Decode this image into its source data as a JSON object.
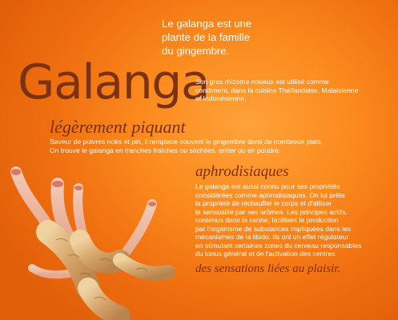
{
  "intro": {
    "lines": [
      "Le galanga est une",
      "plante de la famille",
      "du gingembre."
    ]
  },
  "title": "Galanga",
  "rhizome": {
    "lines": [
      "Son gros rhizome noueux est utilisé comme",
      "condiment, dans la cuisine Thaïlandaise, Malaisienne",
      "et Indonésienne."
    ]
  },
  "flavor": {
    "heading": "légèrement piquant",
    "lines": [
      "Saveur de poivres noirs et pin, il remplace souvent le gingembre dans de nombreux plats.",
      "On trouve le galanga en tranches fraîches ou séchées, entier ou en poudre."
    ]
  },
  "aphro": {
    "heading": "aphrodisiaques",
    "lines": [
      "Le galanga est aussi connu pour ses propriétés",
      "considérées comme aphrodisiaques. On lui prête",
      "la propriété de réchauffer le corps et d'attiser",
      "la sensualité par ses arômes. Les principes actifs,",
      "contenus dans la racine, facilitent la production",
      "par l'organisme de substances impliquées dans les",
      "mécanismes de la libido. Ils ont un effet régulateur",
      "en stimulant certaines zones du cerveau responsables",
      "du tonus général et de l'activation des centres"
    ],
    "closing": "des sensations liées au plaisir."
  },
  "colors": {
    "background": "#f57c14",
    "heading_brown": "#7a2f10",
    "root": "#d9b07a"
  }
}
